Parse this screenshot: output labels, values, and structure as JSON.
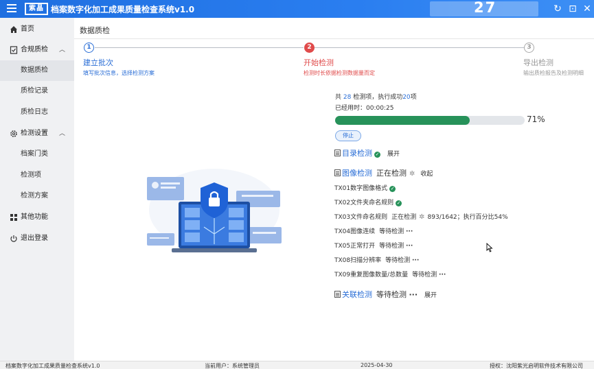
{
  "app": {
    "logo_text": "紫晶",
    "title": "档案数字化加工成果质量检查系统v1.0",
    "counter": "27",
    "window_buttons": {
      "refresh": "↻",
      "restore": "⊡",
      "close": "✕"
    }
  },
  "sidebar": {
    "home": "首页",
    "compliance": {
      "label": "合规质检",
      "children": [
        "数据质检",
        "质检记录",
        "质检日志"
      ]
    },
    "settings": {
      "label": "检测设置",
      "children": [
        "档案门类",
        "检测项",
        "检测方案"
      ]
    },
    "other": "其他功能",
    "logout": "退出登录"
  },
  "main": {
    "page_title": "数据质检",
    "steps": [
      {
        "num": "1",
        "title": "建立批次",
        "desc": "填写批次信息，选择检测方案"
      },
      {
        "num": "2",
        "title": "开始检测",
        "desc": "检测时长依据检测数据量而定"
      },
      {
        "num": "3",
        "title": "导出检测",
        "desc": "输出质检报告及检测明细"
      }
    ],
    "summary": {
      "prefix": "共 ",
      "total": "28",
      "mid": " 检测项，执行成功",
      "success": "20",
      "suffix": "项",
      "elapsed": "已经用时：00:00:25"
    },
    "progress": {
      "value": 0.71,
      "label": "71%"
    },
    "stop_label": "停止",
    "sections": {
      "catalog": {
        "label": "目录检测",
        "toggle": "展开"
      },
      "image": {
        "label": "图像检测",
        "status": "正在检测",
        "toggle": "收起"
      },
      "relation": {
        "label": "关联检测",
        "status": "等待检测",
        "toggle": "展开"
      }
    },
    "items": [
      {
        "name": "TX01数字图像格式",
        "status": ""
      },
      {
        "name": "TX02文件夹命名规则",
        "status": ""
      },
      {
        "name": "TX03文件命名规则",
        "status": "正在检测",
        "detail": "893/1642；执行百分比54%"
      },
      {
        "name": "TX04图像连续",
        "status": "等待检测"
      },
      {
        "name": "TX05正常打开",
        "status": "等待检测"
      },
      {
        "name": "TX08扫描分辨率",
        "status": "等待检测"
      },
      {
        "name": "TX09重复图像数量/总数量",
        "status": "等待检测"
      }
    ],
    "dots": "···"
  },
  "statusbar": {
    "app_name": "档案数字化加工成果质量检查系统v1.0",
    "user": "当前用户：系统管理员",
    "date": "2025-04-30",
    "license": "授权：沈阳紫光启明软件技术有限公司"
  },
  "colors": {
    "primary": "#2a7ef0",
    "active_step": "#e04b4b",
    "success": "#27925a",
    "link": "#2a6ed6"
  }
}
